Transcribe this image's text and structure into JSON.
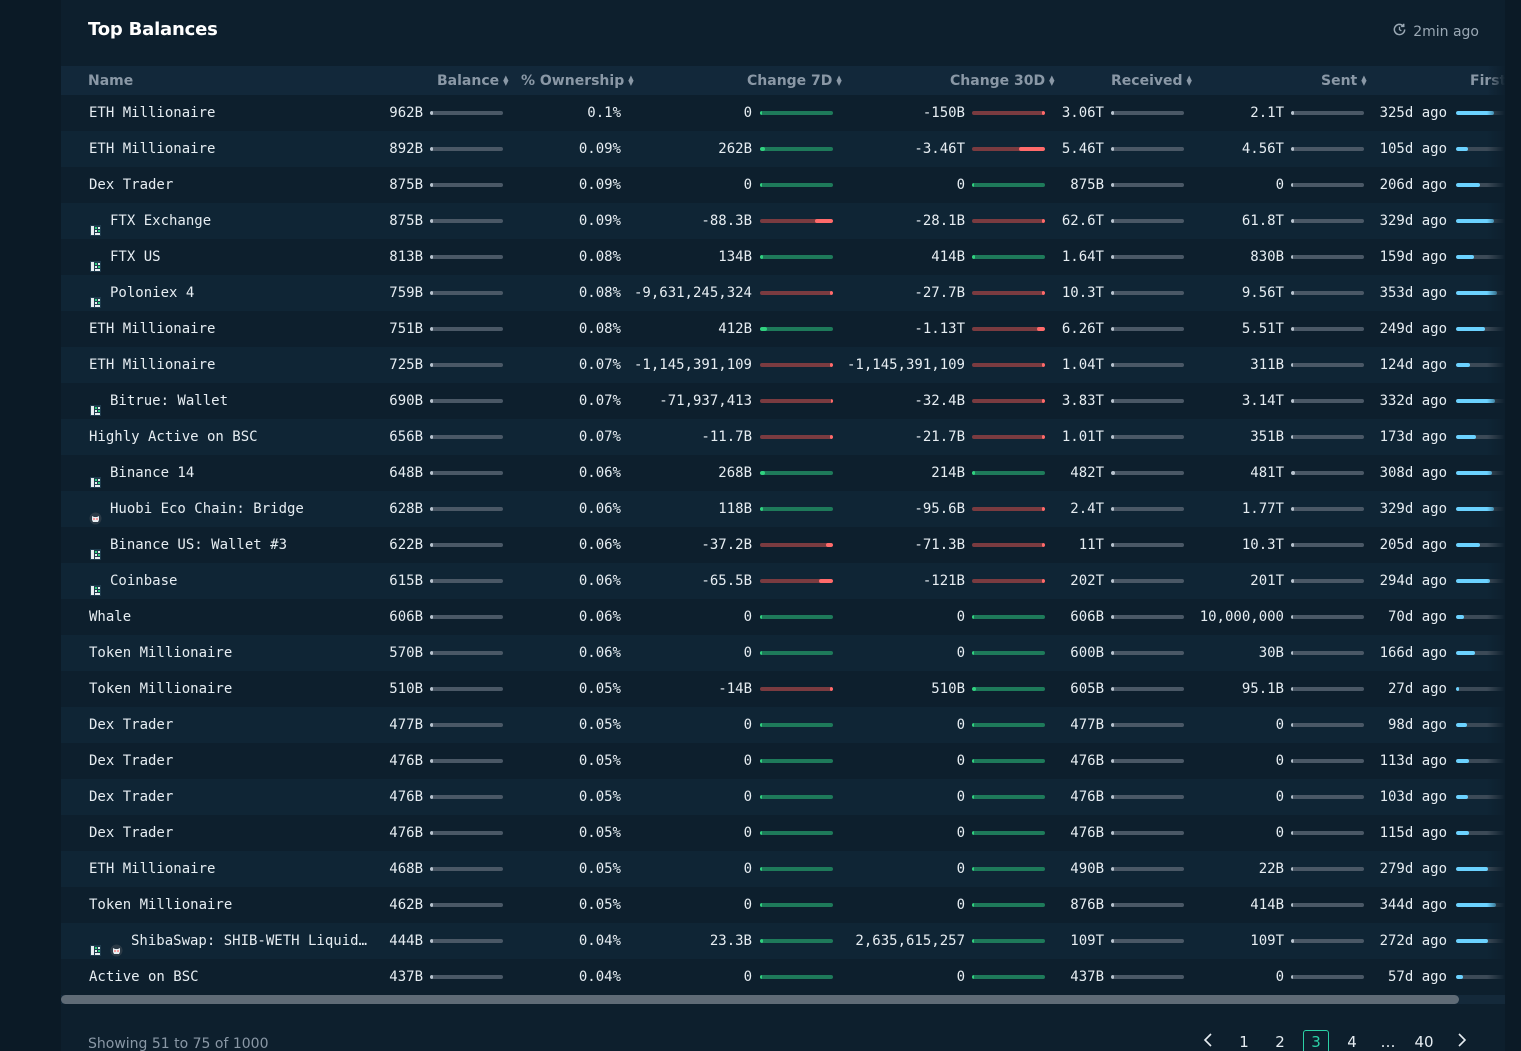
{
  "title": "Top Balances",
  "refresh_label": "2min ago",
  "columns": {
    "name": "Name",
    "balance": "Balance",
    "ownership": "% Ownership",
    "change7d": "Change 7D",
    "change30d": "Change 30D",
    "received": "Received",
    "sent": "Sent",
    "first": "First I"
  },
  "rows": [
    {
      "name": "ETH Millionaire",
      "icons": [],
      "balance": "962B",
      "balance_level": 0.02,
      "ownership": "0.1%",
      "c7": "0",
      "c7_dir": "pos",
      "c7_level": 0.0,
      "c30": "-150B",
      "c30_dir": "neg",
      "c30_level": 0.02,
      "received": "3.06T",
      "received_level": 0.01,
      "sent": "2.1T",
      "sent_level": 0.01,
      "first": "325d ago",
      "first_level": 0.78
    },
    {
      "name": "ETH Millionaire",
      "icons": [],
      "balance": "892B",
      "balance_level": 0.02,
      "ownership": "0.09%",
      "c7": "262B",
      "c7_dir": "pos",
      "c7_level": 0.07,
      "c30": "-3.46T",
      "c30_dir": "neg",
      "c30_level": 0.36,
      "received": "5.46T",
      "received_level": 0.01,
      "sent": "4.56T",
      "sent_level": 0.01,
      "first": "105d ago",
      "first_level": 0.25
    },
    {
      "name": "Dex Trader",
      "icons": [],
      "balance": "875B",
      "balance_level": 0.02,
      "ownership": "0.09%",
      "c7": "0",
      "c7_dir": "pos",
      "c7_level": 0.0,
      "c30": "0",
      "c30_dir": "pos",
      "c30_level": 0.0,
      "received": "875B",
      "received_level": 0.01,
      "sent": "0",
      "sent_level": 0.0,
      "first": "206d ago",
      "first_level": 0.48
    },
    {
      "name": "FTX Exchange",
      "icons": [
        "exchange-icon"
      ],
      "balance": "875B",
      "balance_level": 0.02,
      "ownership": "0.09%",
      "c7": "-88.3B",
      "c7_dir": "neg",
      "c7_level": 0.25,
      "c30": "-28.1B",
      "c30_dir": "neg",
      "c30_level": 0.01,
      "received": "62.6T",
      "received_level": 0.01,
      "sent": "61.8T",
      "sent_level": 0.01,
      "first": "329d ago",
      "first_level": 0.78
    },
    {
      "name": "FTX US",
      "icons": [
        "exchange-icon"
      ],
      "balance": "813B",
      "balance_level": 0.02,
      "ownership": "0.08%",
      "c7": "134B",
      "c7_dir": "pos",
      "c7_level": 0.02,
      "c30": "414B",
      "c30_dir": "pos",
      "c30_level": 0.03,
      "received": "1.64T",
      "received_level": 0.01,
      "sent": "830B",
      "sent_level": 0.0,
      "first": "159d ago",
      "first_level": 0.37
    },
    {
      "name": "Poloniex 4",
      "icons": [
        "exchange-icon"
      ],
      "balance": "759B",
      "balance_level": 0.02,
      "ownership": "0.08%",
      "c7": "-9,631,245,324",
      "c7_dir": "neg",
      "c7_level": 0.02,
      "c30": "-27.7B",
      "c30_dir": "neg",
      "c30_level": 0.01,
      "received": "10.3T",
      "received_level": 0.01,
      "sent": "9.56T",
      "sent_level": 0.01,
      "first": "353d ago",
      "first_level": 0.84
    },
    {
      "name": "ETH Millionaire",
      "icons": [],
      "balance": "751B",
      "balance_level": 0.02,
      "ownership": "0.08%",
      "c7": "412B",
      "c7_dir": "pos",
      "c7_level": 0.09,
      "c30": "-1.13T",
      "c30_dir": "neg",
      "c30_level": 0.11,
      "received": "6.26T",
      "received_level": 0.01,
      "sent": "5.51T",
      "sent_level": 0.01,
      "first": "249d ago",
      "first_level": 0.59
    },
    {
      "name": "ETH Millionaire",
      "icons": [],
      "balance": "725B",
      "balance_level": 0.02,
      "ownership": "0.07%",
      "c7": "-1,145,391,109",
      "c7_dir": "neg",
      "c7_level": 0.01,
      "c30": "-1,145,391,109",
      "c30_dir": "neg",
      "c30_level": 0.01,
      "received": "1.04T",
      "received_level": 0.01,
      "sent": "311B",
      "sent_level": 0.0,
      "first": "124d ago",
      "first_level": 0.29
    },
    {
      "name": "Bitrue: Wallet",
      "icons": [
        "exchange-icon"
      ],
      "balance": "690B",
      "balance_level": 0.02,
      "ownership": "0.07%",
      "c7": "-71,937,413",
      "c7_dir": "neg",
      "c7_level": 0.0,
      "c30": "-32.4B",
      "c30_dir": "neg",
      "c30_level": 0.01,
      "received": "3.83T",
      "received_level": 0.01,
      "sent": "3.14T",
      "sent_level": 0.01,
      "first": "332d ago",
      "first_level": 0.79
    },
    {
      "name": "Highly Active on BSC",
      "icons": [],
      "balance": "656B",
      "balance_level": 0.02,
      "ownership": "0.07%",
      "c7": "-11.7B",
      "c7_dir": "neg",
      "c7_level": 0.03,
      "c30": "-21.7B",
      "c30_dir": "neg",
      "c30_level": 0.01,
      "received": "1.01T",
      "received_level": 0.01,
      "sent": "351B",
      "sent_level": 0.0,
      "first": "173d ago",
      "first_level": 0.41
    },
    {
      "name": "Binance 14",
      "icons": [
        "exchange-icon"
      ],
      "balance": "648B",
      "balance_level": 0.02,
      "ownership": "0.06%",
      "c7": "268B",
      "c7_dir": "pos",
      "c7_level": 0.07,
      "c30": "214B",
      "c30_dir": "pos",
      "c30_level": 0.02,
      "received": "482T",
      "received_level": 0.06,
      "sent": "481T",
      "sent_level": 0.06,
      "first": "308d ago",
      "first_level": 0.73
    },
    {
      "name": "Huobi Eco Chain: Bridge",
      "icons": [
        "bridge-icon"
      ],
      "balance": "628B",
      "balance_level": 0.02,
      "ownership": "0.06%",
      "c7": "118B",
      "c7_dir": "pos",
      "c7_level": 0.02,
      "c30": "-95.6B",
      "c30_dir": "neg",
      "c30_level": 0.01,
      "received": "2.4T",
      "received_level": 0.01,
      "sent": "1.77T",
      "sent_level": 0.01,
      "first": "329d ago",
      "first_level": 0.78
    },
    {
      "name": "Binance US: Wallet #3",
      "icons": [
        "exchange-icon"
      ],
      "balance": "622B",
      "balance_level": 0.02,
      "ownership": "0.06%",
      "c7": "-37.2B",
      "c7_dir": "neg",
      "c7_level": 0.1,
      "c30": "-71.3B",
      "c30_dir": "neg",
      "c30_level": 0.01,
      "received": "11T",
      "received_level": 0.01,
      "sent": "10.3T",
      "sent_level": 0.01,
      "first": "205d ago",
      "first_level": 0.48
    },
    {
      "name": "Coinbase",
      "icons": [
        "exchange-icon"
      ],
      "balance": "615B",
      "balance_level": 0.02,
      "ownership": "0.06%",
      "c7": "-65.5B",
      "c7_dir": "neg",
      "c7_level": 0.19,
      "c30": "-121B",
      "c30_dir": "neg",
      "c30_level": 0.01,
      "received": "202T",
      "received_level": 0.02,
      "sent": "201T",
      "sent_level": 0.02,
      "first": "294d ago",
      "first_level": 0.7
    },
    {
      "name": "Whale",
      "icons": [],
      "balance": "606B",
      "balance_level": 0.02,
      "ownership": "0.06%",
      "c7": "0",
      "c7_dir": "pos",
      "c7_level": 0.0,
      "c30": "0",
      "c30_dir": "pos",
      "c30_level": 0.0,
      "received": "606B",
      "received_level": 0.01,
      "sent": "10,000,000",
      "sent_level": 0.0,
      "first": "70d ago",
      "first_level": 0.17
    },
    {
      "name": "Token Millionaire",
      "icons": [],
      "balance": "570B",
      "balance_level": 0.02,
      "ownership": "0.06%",
      "c7": "0",
      "c7_dir": "pos",
      "c7_level": 0.0,
      "c30": "0",
      "c30_dir": "pos",
      "c30_level": 0.0,
      "received": "600B",
      "received_level": 0.01,
      "sent": "30B",
      "sent_level": 0.0,
      "first": "166d ago",
      "first_level": 0.39
    },
    {
      "name": "Token Millionaire",
      "icons": [],
      "balance": "510B",
      "balance_level": 0.02,
      "ownership": "0.05%",
      "c7": "-14B",
      "c7_dir": "neg",
      "c7_level": 0.03,
      "c30": "510B",
      "c30_dir": "pos",
      "c30_level": 0.05,
      "received": "605B",
      "received_level": 0.01,
      "sent": "95.1B",
      "sent_level": 0.0,
      "first": "27d ago",
      "first_level": 0.06
    },
    {
      "name": "Dex Trader",
      "icons": [],
      "balance": "477B",
      "balance_level": 0.02,
      "ownership": "0.05%",
      "c7": "0",
      "c7_dir": "pos",
      "c7_level": 0.0,
      "c30": "0",
      "c30_dir": "pos",
      "c30_level": 0.0,
      "received": "477B",
      "received_level": 0.01,
      "sent": "0",
      "sent_level": 0.0,
      "first": "98d ago",
      "first_level": 0.23
    },
    {
      "name": "Dex Trader",
      "icons": [],
      "balance": "476B",
      "balance_level": 0.02,
      "ownership": "0.05%",
      "c7": "0",
      "c7_dir": "pos",
      "c7_level": 0.0,
      "c30": "0",
      "c30_dir": "pos",
      "c30_level": 0.0,
      "received": "476B",
      "received_level": 0.01,
      "sent": "0",
      "sent_level": 0.0,
      "first": "113d ago",
      "first_level": 0.27
    },
    {
      "name": "Dex Trader",
      "icons": [],
      "balance": "476B",
      "balance_level": 0.02,
      "ownership": "0.05%",
      "c7": "0",
      "c7_dir": "pos",
      "c7_level": 0.0,
      "c30": "0",
      "c30_dir": "pos",
      "c30_level": 0.0,
      "received": "476B",
      "received_level": 0.01,
      "sent": "0",
      "sent_level": 0.0,
      "first": "103d ago",
      "first_level": 0.24
    },
    {
      "name": "Dex Trader",
      "icons": [],
      "balance": "476B",
      "balance_level": 0.02,
      "ownership": "0.05%",
      "c7": "0",
      "c7_dir": "pos",
      "c7_level": 0.0,
      "c30": "0",
      "c30_dir": "pos",
      "c30_level": 0.0,
      "received": "476B",
      "received_level": 0.01,
      "sent": "0",
      "sent_level": 0.0,
      "first": "115d ago",
      "first_level": 0.27
    },
    {
      "name": "ETH Millionaire",
      "icons": [],
      "balance": "468B",
      "balance_level": 0.02,
      "ownership": "0.05%",
      "c7": "0",
      "c7_dir": "pos",
      "c7_level": 0.0,
      "c30": "0",
      "c30_dir": "pos",
      "c30_level": 0.0,
      "received": "490B",
      "received_level": 0.01,
      "sent": "22B",
      "sent_level": 0.0,
      "first": "279d ago",
      "first_level": 0.66
    },
    {
      "name": "Token Millionaire",
      "icons": [],
      "balance": "462B",
      "balance_level": 0.02,
      "ownership": "0.05%",
      "c7": "0",
      "c7_dir": "pos",
      "c7_level": 0.0,
      "c30": "0",
      "c30_dir": "pos",
      "c30_level": 0.0,
      "received": "876B",
      "received_level": 0.01,
      "sent": "414B",
      "sent_level": 0.0,
      "first": "344d ago",
      "first_level": 0.82
    },
    {
      "name": "ShibaSwap: SHIB-WETH Liquid…",
      "icons": [
        "exchange-icon",
        "bridge-icon"
      ],
      "balance": "444B",
      "balance_level": 0.02,
      "ownership": "0.04%",
      "c7": "23.3B",
      "c7_dir": "pos",
      "c7_level": 0.01,
      "c30": "2,635,615,257",
      "c30_dir": "pos",
      "c30_level": 0.0,
      "received": "109T",
      "received_level": 0.01,
      "sent": "109T",
      "sent_level": 0.01,
      "first": "272d ago",
      "first_level": 0.65
    },
    {
      "name": "Active on BSC",
      "icons": [],
      "balance": "437B",
      "balance_level": 0.02,
      "ownership": "0.04%",
      "c7": "0",
      "c7_dir": "pos",
      "c7_level": 0.0,
      "c30": "0",
      "c30_dir": "pos",
      "c30_level": 0.0,
      "received": "437B",
      "received_level": 0.01,
      "sent": "0",
      "sent_level": 0.0,
      "first": "57d ago",
      "first_level": 0.14
    }
  ],
  "footer": {
    "showing": "Showing 51 to 75 of 1000",
    "pages": [
      "1",
      "2",
      "3",
      "4",
      "…",
      "40"
    ],
    "current_page": "3"
  },
  "colors": {
    "positive": "#30d17f",
    "negative": "#ff6b6b",
    "time": "#6bd2ff",
    "accent": "#2bd1a6"
  }
}
